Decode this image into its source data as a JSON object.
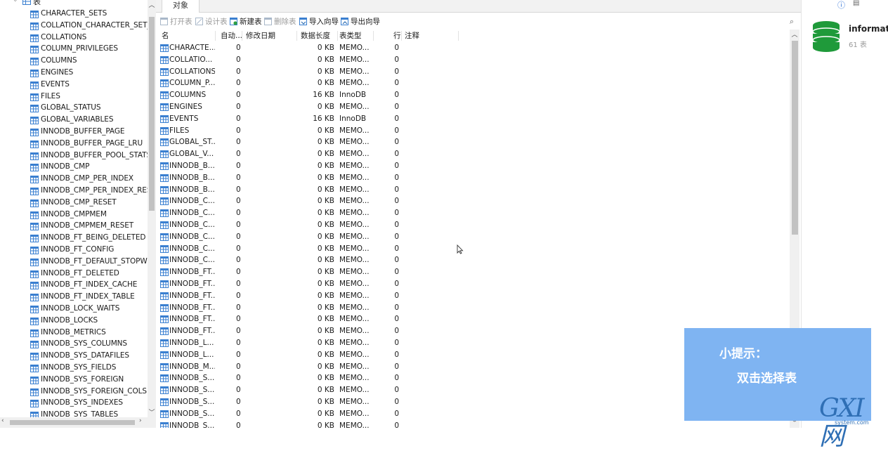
{
  "tree": {
    "header_label": "表",
    "items": [
      "CHARACTER_SETS",
      "COLLATION_CHARACTER_SET_",
      "COLLATIONS",
      "COLUMN_PRIVILEGES",
      "COLUMNS",
      "ENGINES",
      "EVENTS",
      "FILES",
      "GLOBAL_STATUS",
      "GLOBAL_VARIABLES",
      "INNODB_BUFFER_PAGE",
      "INNODB_BUFFER_PAGE_LRU",
      "INNODB_BUFFER_POOL_STATS",
      "INNODB_CMP",
      "INNODB_CMP_PER_INDEX",
      "INNODB_CMP_PER_INDEX_RESE",
      "INNODB_CMP_RESET",
      "INNODB_CMPMEM",
      "INNODB_CMPMEM_RESET",
      "INNODB_FT_BEING_DELETED",
      "INNODB_FT_CONFIG",
      "INNODB_FT_DEFAULT_STOPWC",
      "INNODB_FT_DELETED",
      "INNODB_FT_INDEX_CACHE",
      "INNODB_FT_INDEX_TABLE",
      "INNODB_LOCK_WAITS",
      "INNODB_LOCKS",
      "INNODB_METRICS",
      "INNODB_SYS_COLUMNS",
      "INNODB_SYS_DATAFILES",
      "INNODB_SYS_FIELDS",
      "INNODB_SYS_FOREIGN",
      "INNODB_SYS_FOREIGN_COLS",
      "INNODB_SYS_INDEXES",
      "INNODB_SYS_TABLES"
    ]
  },
  "tab": {
    "label": "对象"
  },
  "toolbar": {
    "open_table": "打开表",
    "design_table": "设计表",
    "new_table": "新建表",
    "delete_table": "删除表",
    "import_wizard": "导入向导",
    "export_wizard": "导出向导"
  },
  "grid": {
    "headers": {
      "name": "名",
      "auto_inc": "自动...",
      "modified": "修改日期",
      "data_length": "数据长度",
      "engine": "表类型",
      "rows": "行",
      "comment": "注释"
    },
    "rows": [
      {
        "name": "CHARACTE...",
        "auto": "0",
        "size": "0 KB",
        "type": "MEMO...",
        "rows": "0"
      },
      {
        "name": "COLLATIO...",
        "auto": "0",
        "size": "0 KB",
        "type": "MEMO...",
        "rows": "0"
      },
      {
        "name": "COLLATIONS",
        "auto": "0",
        "size": "0 KB",
        "type": "MEMO...",
        "rows": "0"
      },
      {
        "name": "COLUMN_P...",
        "auto": "0",
        "size": "0 KB",
        "type": "MEMO...",
        "rows": "0"
      },
      {
        "name": "COLUMNS",
        "auto": "0",
        "size": "16 KB",
        "type": "InnoDB",
        "rows": "0"
      },
      {
        "name": "ENGINES",
        "auto": "0",
        "size": "0 KB",
        "type": "MEMO...",
        "rows": "0"
      },
      {
        "name": "EVENTS",
        "auto": "0",
        "size": "16 KB",
        "type": "InnoDB",
        "rows": "0"
      },
      {
        "name": "FILES",
        "auto": "0",
        "size": "0 KB",
        "type": "MEMO...",
        "rows": "0"
      },
      {
        "name": "GLOBAL_ST...",
        "auto": "0",
        "size": "0 KB",
        "type": "MEMO...",
        "rows": "0"
      },
      {
        "name": "GLOBAL_V...",
        "auto": "0",
        "size": "0 KB",
        "type": "MEMO...",
        "rows": "0"
      },
      {
        "name": "INNODB_B...",
        "auto": "0",
        "size": "0 KB",
        "type": "MEMO...",
        "rows": "0"
      },
      {
        "name": "INNODB_B...",
        "auto": "0",
        "size": "0 KB",
        "type": "MEMO...",
        "rows": "0"
      },
      {
        "name": "INNODB_B...",
        "auto": "0",
        "size": "0 KB",
        "type": "MEMO...",
        "rows": "0"
      },
      {
        "name": "INNODB_C...",
        "auto": "0",
        "size": "0 KB",
        "type": "MEMO...",
        "rows": "0"
      },
      {
        "name": "INNODB_C...",
        "auto": "0",
        "size": "0 KB",
        "type": "MEMO...",
        "rows": "0"
      },
      {
        "name": "INNODB_C...",
        "auto": "0",
        "size": "0 KB",
        "type": "MEMO...",
        "rows": "0"
      },
      {
        "name": "INNODB_C...",
        "auto": "0",
        "size": "0 KB",
        "type": "MEMO...",
        "rows": "0"
      },
      {
        "name": "INNODB_C...",
        "auto": "0",
        "size": "0 KB",
        "type": "MEMO...",
        "rows": "0"
      },
      {
        "name": "INNODB_C...",
        "auto": "0",
        "size": "0 KB",
        "type": "MEMO...",
        "rows": "0"
      },
      {
        "name": "INNODB_FT...",
        "auto": "0",
        "size": "0 KB",
        "type": "MEMO...",
        "rows": "0"
      },
      {
        "name": "INNODB_FT...",
        "auto": "0",
        "size": "0 KB",
        "type": "MEMO...",
        "rows": "0"
      },
      {
        "name": "INNODB_FT...",
        "auto": "0",
        "size": "0 KB",
        "type": "MEMO...",
        "rows": "0"
      },
      {
        "name": "INNODB_FT...",
        "auto": "0",
        "size": "0 KB",
        "type": "MEMO...",
        "rows": "0"
      },
      {
        "name": "INNODB_FT...",
        "auto": "0",
        "size": "0 KB",
        "type": "MEMO...",
        "rows": "0"
      },
      {
        "name": "INNODB_FT...",
        "auto": "0",
        "size": "0 KB",
        "type": "MEMO...",
        "rows": "0"
      },
      {
        "name": "INNODB_L...",
        "auto": "0",
        "size": "0 KB",
        "type": "MEMO...",
        "rows": "0"
      },
      {
        "name": "INNODB_L...",
        "auto": "0",
        "size": "0 KB",
        "type": "MEMO...",
        "rows": "0"
      },
      {
        "name": "INNODB_M...",
        "auto": "0",
        "size": "0 KB",
        "type": "MEMO...",
        "rows": "0"
      },
      {
        "name": "INNODB_S...",
        "auto": "0",
        "size": "0 KB",
        "type": "MEMO...",
        "rows": "0"
      },
      {
        "name": "INNODB_S...",
        "auto": "0",
        "size": "0 KB",
        "type": "MEMO...",
        "rows": "0"
      },
      {
        "name": "INNODB_S...",
        "auto": "0",
        "size": "0 KB",
        "type": "MEMO...",
        "rows": "0"
      },
      {
        "name": "INNODB_S...",
        "auto": "0",
        "size": "0 KB",
        "type": "MEMO...",
        "rows": "0"
      },
      {
        "name": "INNODB_S...",
        "auto": "0",
        "size": "0 KB",
        "type": "MEMO...",
        "rows": "0"
      }
    ]
  },
  "info_panel": {
    "db_name": "informatio",
    "table_count": "61 表"
  },
  "tip": {
    "title": "小提示：",
    "body": "双击选择表"
  },
  "watermark": {
    "logo": "GXI网",
    "site": "system.com"
  },
  "colors": {
    "tip_bg": "#7fb4f2",
    "db_icon": "#1f9a3a",
    "info_icon": "#2b6fd6",
    "watermark": "#2f6fb5"
  }
}
